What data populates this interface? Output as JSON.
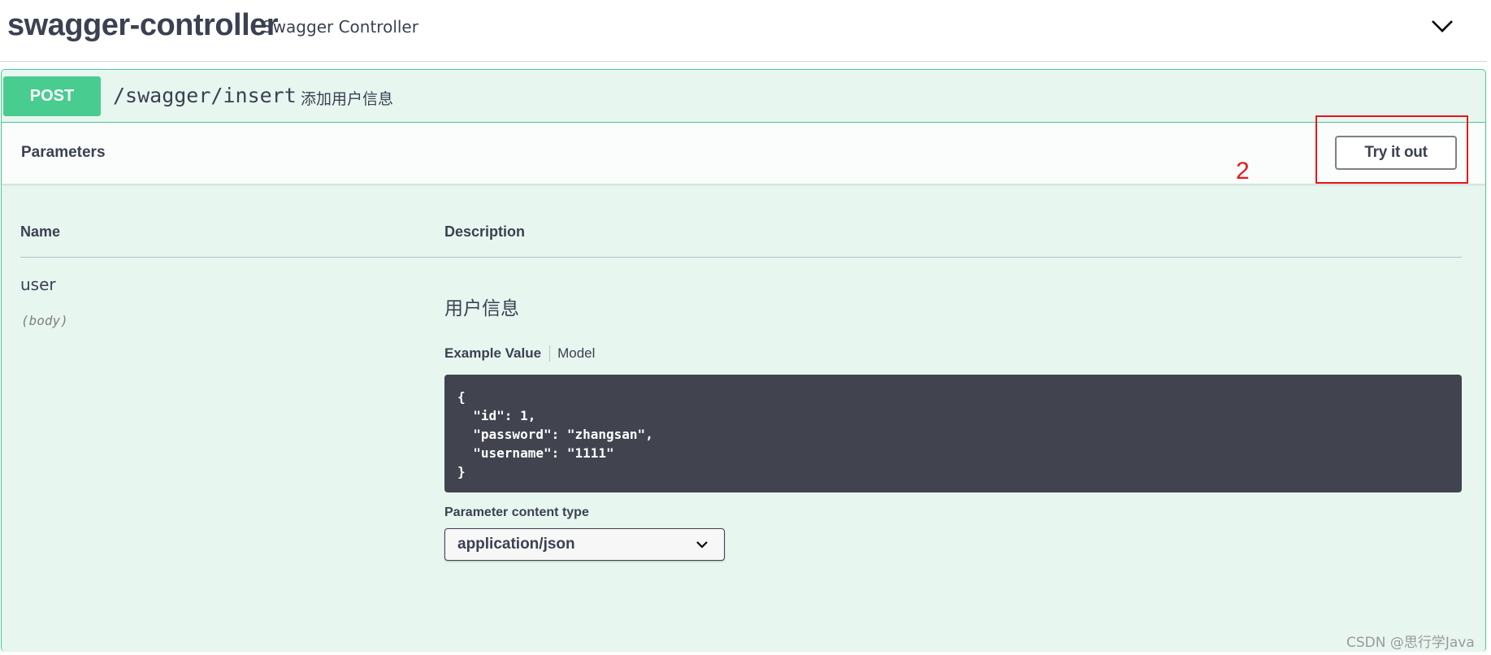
{
  "tag": {
    "name": "swagger-controller",
    "description": "Swagger Controller",
    "chevron_icon": "chevron-down-icon"
  },
  "operation": {
    "method": "POST",
    "path": "/swagger/insert",
    "summary": "添加用户信息",
    "colors": {
      "method": "#49cc90",
      "background": "#e8f6f0",
      "border": "#49cc90"
    }
  },
  "parameters_section": {
    "title": "Parameters",
    "try_button": "Try it out",
    "annotation_number": "2",
    "annotation_color": "#e61919"
  },
  "table": {
    "headers": {
      "name": "Name",
      "description": "Description"
    }
  },
  "param": {
    "name": "user",
    "in": "(body)",
    "description": "用户信息",
    "tabs": {
      "example": "Example Value",
      "model": "Model"
    },
    "example_code": "{\n  \"id\": 1,\n  \"password\": \"zhangsan\",\n  \"username\": \"1111\"\n}",
    "content_type_label": "Parameter content type",
    "content_type_value": "application/json"
  },
  "watermark": "CSDN @思行学Java"
}
